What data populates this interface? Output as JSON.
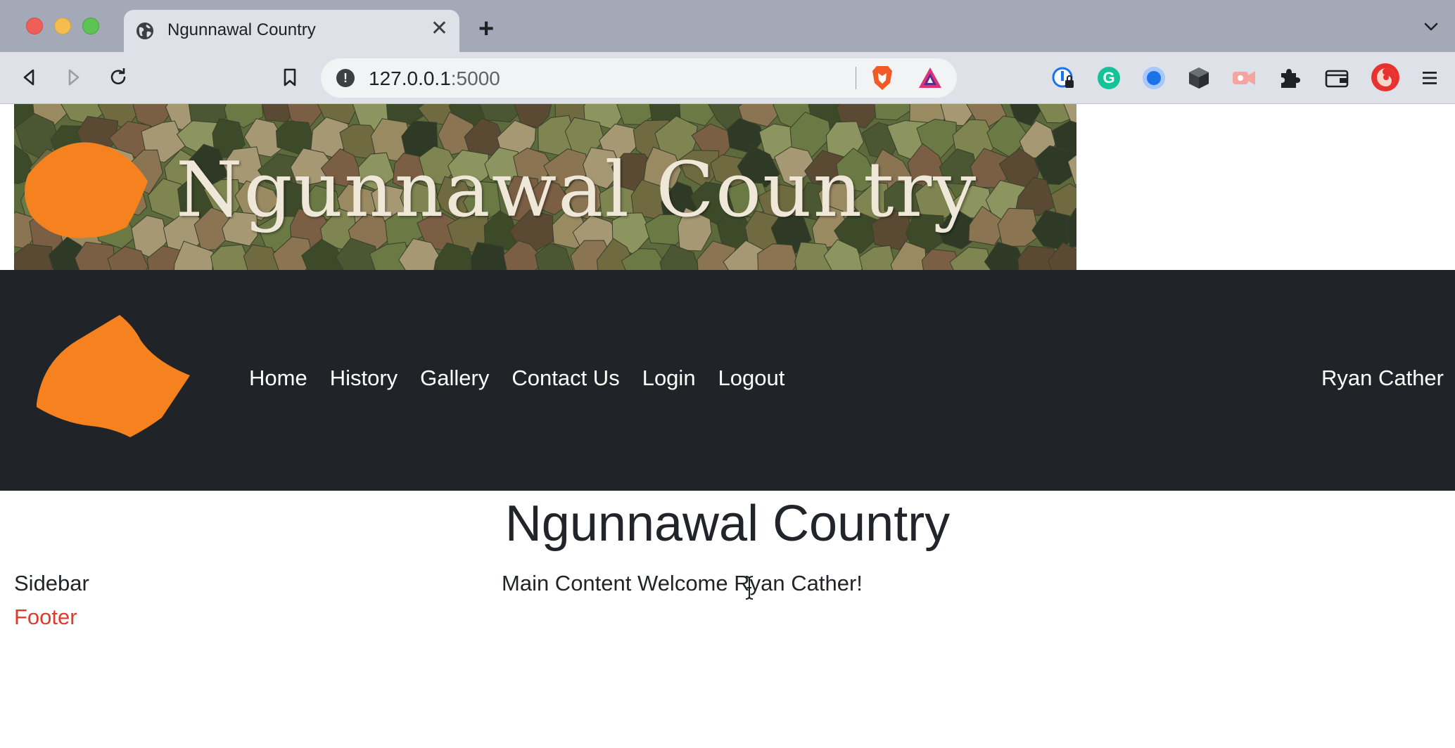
{
  "browser": {
    "tab": {
      "title": "Ngunnawal Country",
      "favicon": "globe-icon",
      "close_glyph": "✕"
    },
    "new_tab_glyph": "+",
    "address_bar": {
      "host": "127.0.0.1",
      "port": ":5000",
      "security_icon": "info-icon",
      "info_glyph": "!"
    },
    "nav_icons": [
      "back-icon",
      "forward-icon",
      "reload-icon",
      "bookmark-icon"
    ],
    "extensions": [
      "brave-shields-icon",
      "brave-rewards-icon",
      "password-manager-icon",
      "grammarly-icon",
      "blue-circle-extension-icon",
      "cube-extension-icon",
      "video-extension-icon",
      "extensions-puzzle-icon",
      "wallet-icon",
      "profile-avatar-icon",
      "menu-icon"
    ],
    "grammarly_glyph": "G"
  },
  "page": {
    "banner": {
      "title": "Ngunnawal Country"
    },
    "nav": {
      "links": [
        "Home",
        "History",
        "Gallery",
        "Contact Us",
        "Login",
        "Logout"
      ],
      "user": "Ryan Cather"
    },
    "heading": "Ngunnawal Country",
    "sidebar": "Sidebar",
    "main_content": "Main Content Welcome Ryan Cather!",
    "footer": "Footer"
  },
  "colors": {
    "navbar": "#202328",
    "logo_orange": "#f5821f",
    "footer_text": "#dc3c2c",
    "tabstrip": "#a4a9b7",
    "toolbar": "#dee1e7"
  }
}
